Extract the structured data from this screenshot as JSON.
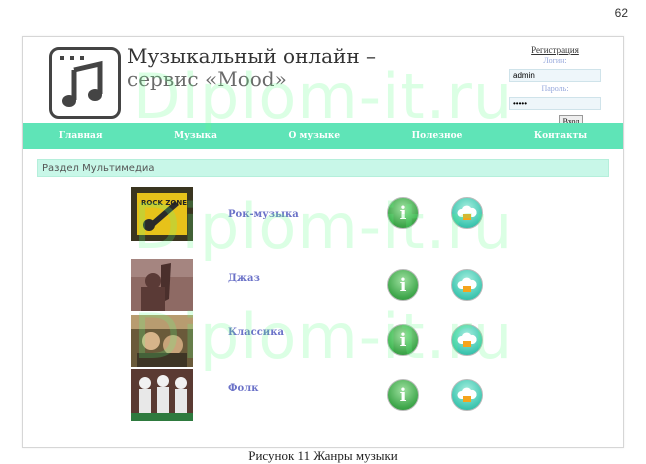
{
  "page_number": "62",
  "header": {
    "title": "Музыкальный онлайн –",
    "subtitle": "сервис «Mood»"
  },
  "auth": {
    "register_link": "Регистрация",
    "login_label": "Логин:",
    "login_value": "admin",
    "password_label": "Пароль:",
    "password_value": "•••••",
    "submit_label": "Вход"
  },
  "nav": {
    "items": [
      "Главная",
      "Музыка",
      "О музыке",
      "Полезное",
      "Контакты"
    ]
  },
  "section_title": "Раздел Мультимедиа",
  "genres": [
    {
      "name": "Рок-музыка",
      "thumb_text": "ROCK ZONE"
    },
    {
      "name": "Джаз"
    },
    {
      "name": "Классика"
    },
    {
      "name": "Фолк"
    }
  ],
  "icons": {
    "info": "i"
  },
  "watermark": "Diplom-it.ru",
  "caption": "Рисунок 11 Жанры музыки",
  "colors": {
    "nav": "#5fe4b7",
    "section": "#c8f7e8",
    "link": "#6b72c8"
  }
}
